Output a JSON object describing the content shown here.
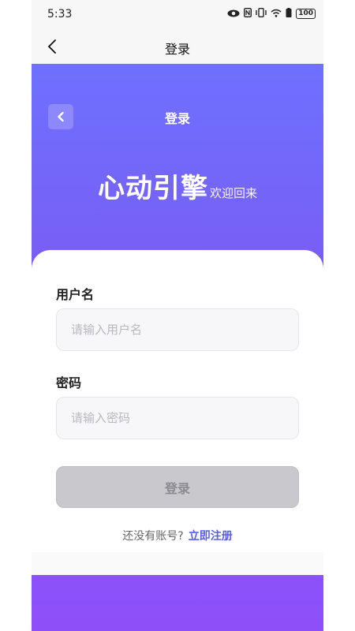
{
  "status_bar": {
    "time": "5:33",
    "battery": "100"
  },
  "nav": {
    "title": "登录",
    "back_icon": "chevron-left-icon"
  },
  "hero": {
    "title": "登录",
    "brand_name": "心动引擎",
    "brand_sub": "欢迎回来",
    "gradient_start": "#6f70ff",
    "gradient_end": "#7b5cf4"
  },
  "form": {
    "username_label": "用户名",
    "username_placeholder": "请输入用户名",
    "password_label": "密码",
    "password_placeholder": "请输入密码",
    "login_button": "登录",
    "register_prompt": "还没有账号?",
    "register_link": "立即注册"
  },
  "colors": {
    "accent": "#5a5de8",
    "bottom_band": "#8b52fb",
    "button_disabled": "#c8c8cd"
  }
}
